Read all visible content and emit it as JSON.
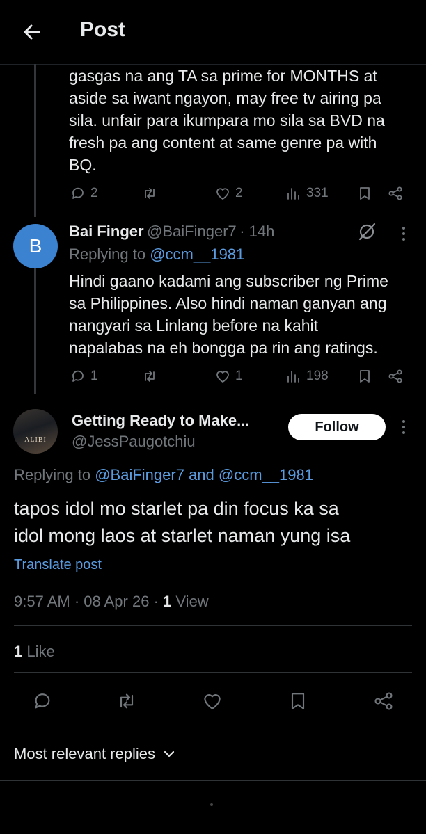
{
  "header": {
    "title": "Post"
  },
  "prev_reply": {
    "text_lines": [
      "gasgas na ang TA sa prime for MONTHS at",
      "aside sa iwant ngayon, may free tv airing pa",
      "sila. unfair para ikumpara mo sila sa BVD na",
      "fresh pa ang content at same genre pa with",
      "BQ."
    ],
    "replies": "2",
    "likes": "2",
    "views": "331"
  },
  "reply_bai": {
    "avatar_letter": "B",
    "avatar_color": "#3b82d0",
    "name": "Bai Finger",
    "handle": "@BaiFinger7",
    "time": "· 14h",
    "replying_prefix": "Replying to",
    "replying_to": "@ccm__1981",
    "text_lines": [
      "Hindi gaano kadami ang subscriber ng Prime",
      "sa Philippines. Also hindi naman ganyan ang",
      "nangyari sa Linlang before na kahit",
      "napalabas na eh bongga pa rin ang ratings."
    ],
    "replies": "1",
    "likes": "1",
    "views": "198"
  },
  "main_post": {
    "name": "Getting Ready to Make...",
    "handle": "@JessPaugotchiu",
    "avatar_text": "ALIBI",
    "follow_label": "Follow",
    "replying_prefix": "Replying to",
    "replying_to_1": "@BaiFinger7",
    "replying_and": "and",
    "replying_to_2": "@ccm__1981",
    "text_lines": [
      "tapos idol mo starlet pa din focus ka sa",
      "idol mong laos at starlet naman yung isa"
    ],
    "translate_label": "Translate post",
    "meta_time": "9:57 AM · 08 Apr 26 ·",
    "view_count": "1",
    "view_label": "View",
    "like_count": "1",
    "like_label": "Like"
  },
  "replies_sort": {
    "label": "Most relevant replies"
  },
  "colors": {
    "accent_link": "#5b9be0",
    "muted": "#71767b",
    "background": "#000000"
  }
}
